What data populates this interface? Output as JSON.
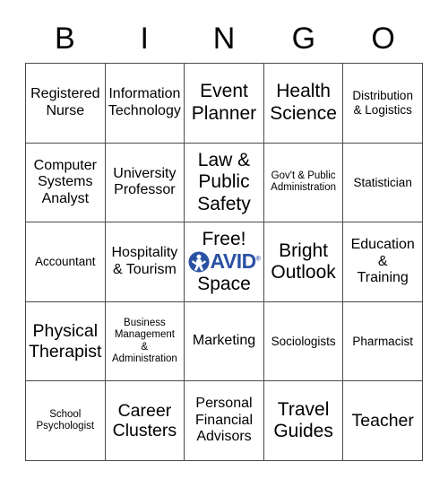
{
  "header": {
    "letters": [
      "B",
      "I",
      "N",
      "G",
      "O"
    ]
  },
  "colors": {
    "grid_line": "#4a4a4a",
    "text": "#000000",
    "background": "#ffffff",
    "avid_blue": "#2a51a3"
  },
  "free_space": {
    "top_label": "Free!",
    "bottom_label": "Space",
    "logo_word": "AVID",
    "logo_tm": "®",
    "logo_icon": "avid-person-circle-icon"
  },
  "grid": {
    "rows": [
      [
        {
          "text": "Registered\nNurse",
          "size": "fs-md"
        },
        {
          "text": "Information\nTechnology",
          "size": "fs-md"
        },
        {
          "text": "Event\nPlanner",
          "size": "fs-xl"
        },
        {
          "text": "Health\nScience",
          "size": "fs-xl"
        },
        {
          "text": "Distribution\n& Logistics",
          "size": "fs-sm"
        }
      ],
      [
        {
          "text": "Computer\nSystems\nAnalyst",
          "size": "fs-md"
        },
        {
          "text": "University\nProfessor",
          "size": "fs-md"
        },
        {
          "text": "Law &\nPublic\nSafety",
          "size": "fs-xl"
        },
        {
          "text": "Gov't & Public\nAdministration",
          "size": "fs-xs"
        },
        {
          "text": "Statistician",
          "size": "fs-sm"
        }
      ],
      [
        {
          "text": "Accountant",
          "size": "fs-sm"
        },
        {
          "text": "Hospitality\n& Tourism",
          "size": "fs-md"
        },
        {
          "text": "",
          "size": "free"
        },
        {
          "text": "Bright\nOutlook",
          "size": "fs-xl"
        },
        {
          "text": "Education\n&\nTraining",
          "size": "fs-md"
        }
      ],
      [
        {
          "text": "Physical\nTherapist",
          "size": "fs-lg"
        },
        {
          "text": "Business\nManagement\n&\nAdministration",
          "size": "fs-xs"
        },
        {
          "text": "Marketing",
          "size": "fs-md"
        },
        {
          "text": "Sociologists",
          "size": "fs-sm"
        },
        {
          "text": "Pharmacist",
          "size": "fs-sm"
        }
      ],
      [
        {
          "text": "School\nPsychologist",
          "size": "fs-xs"
        },
        {
          "text": "Career\nClusters",
          "size": "fs-lg"
        },
        {
          "text": "Personal\nFinancial\nAdvisors",
          "size": "fs-md"
        },
        {
          "text": "Travel\nGuides",
          "size": "fs-xl"
        },
        {
          "text": "Teacher",
          "size": "fs-lg"
        }
      ]
    ]
  }
}
